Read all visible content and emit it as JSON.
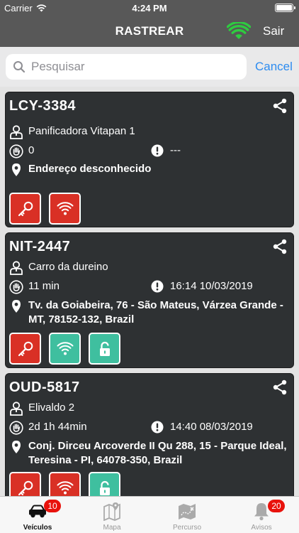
{
  "status_bar": {
    "carrier": "Carrier",
    "time": "4:24 PM"
  },
  "nav": {
    "title": "RASTREAR",
    "logout_label": "Sair",
    "connection_color": "#2ecc40"
  },
  "search": {
    "placeholder": "Pesquisar",
    "value": "",
    "cancel_label": "Cancel"
  },
  "colors": {
    "card_bg": "#2e3133",
    "button_red": "#d93025",
    "button_green": "#3fbf9f",
    "badge": "#e8120c"
  },
  "vehicles": [
    {
      "plate": "LCY-3384",
      "driver": "Panificadora Vitapan 1",
      "stopped_time": "0",
      "last_update": "---",
      "address": "Endereço desconhecido",
      "buttons": [
        {
          "icon": "key-icon",
          "state": "red"
        },
        {
          "icon": "wifi-icon",
          "state": "red"
        }
      ]
    },
    {
      "plate": "NIT-2447",
      "driver": "Carro da dureino",
      "stopped_time": "11 min",
      "last_update": "16:14 10/03/2019",
      "address": "Tv. da Goiabeira, 76 - São Mateus, Várzea Grande - MT, 78152-132, Brazil",
      "buttons": [
        {
          "icon": "key-icon",
          "state": "red"
        },
        {
          "icon": "wifi-icon",
          "state": "green"
        },
        {
          "icon": "lock-icon",
          "state": "green"
        }
      ]
    },
    {
      "plate": "OUD-5817",
      "driver": "Elivaldo 2",
      "stopped_time": "2d 1h 44min",
      "last_update": "14:40 08/03/2019",
      "address": "Conj. Dirceu Arcoverde II Qu 288, 15 - Parque Ideal, Teresina - PI, 64078-350, Brazil",
      "buttons": [
        {
          "icon": "key-icon",
          "state": "red"
        },
        {
          "icon": "wifi-icon",
          "state": "red"
        },
        {
          "icon": "lock-icon",
          "state": "green"
        }
      ]
    }
  ],
  "tabs": [
    {
      "label": "Veículos",
      "icon": "car-icon",
      "badge": "10",
      "active": true
    },
    {
      "label": "Mapa",
      "icon": "map-icon",
      "badge": "",
      "active": false
    },
    {
      "label": "Percurso",
      "icon": "route-map-icon",
      "badge": "",
      "active": false
    },
    {
      "label": "Avisos",
      "icon": "bell-icon",
      "badge": "20",
      "active": false
    }
  ]
}
